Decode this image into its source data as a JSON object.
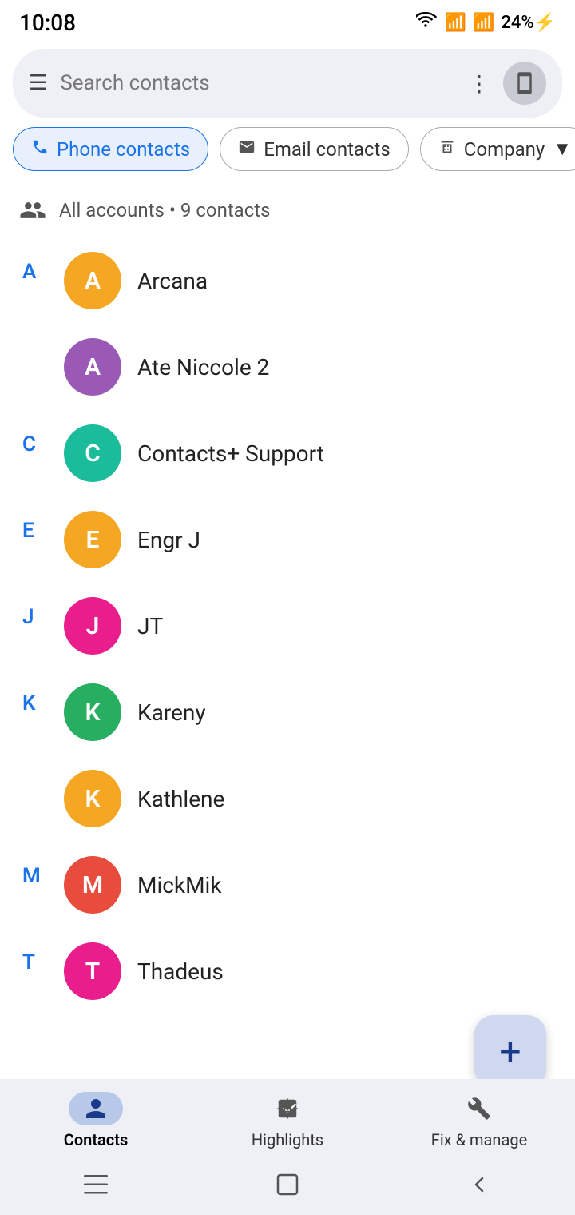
{
  "statusBar": {
    "time": "10:08",
    "battery": "24%",
    "batteryIcon": "⚡"
  },
  "searchBar": {
    "placeholder": "Search contacts",
    "menuIcon": "☰",
    "dotsIcon": "⋮"
  },
  "filterChips": [
    {
      "id": "phone",
      "label": "Phone contacts",
      "icon": "phone",
      "active": true
    },
    {
      "id": "email",
      "label": "Email contacts",
      "icon": "email",
      "active": false
    },
    {
      "id": "company",
      "label": "Company",
      "icon": "company",
      "active": false
    }
  ],
  "accountInfo": {
    "text": "All accounts • 9 contacts"
  },
  "contacts": [
    {
      "letter": "A",
      "name": "Arcana",
      "initial": "A",
      "color": "#F5A623",
      "showLetter": true
    },
    {
      "letter": "A",
      "name": "Ate Niccole 2",
      "initial": "A",
      "color": "#9B59B6",
      "showLetter": false
    },
    {
      "letter": "C",
      "name": "Contacts+ Support",
      "initial": "C",
      "color": "#1ABC9C",
      "showLetter": true
    },
    {
      "letter": "E",
      "name": "Engr J",
      "initial": "E",
      "color": "#F5A623",
      "showLetter": true
    },
    {
      "letter": "J",
      "name": "JT",
      "initial": "J",
      "color": "#E91E8C",
      "showLetter": true
    },
    {
      "letter": "K",
      "name": "Kareny",
      "initial": "K",
      "color": "#27AE60",
      "showLetter": true
    },
    {
      "letter": "K",
      "name": "Kathlene",
      "initial": "K",
      "color": "#F5A623",
      "showLetter": false
    },
    {
      "letter": "M",
      "name": "MickMik",
      "initial": "M",
      "color": "#E74C3C",
      "showLetter": true
    },
    {
      "letter": "T",
      "name": "Thadeus",
      "initial": "T",
      "color": "#E91E8C",
      "showLetter": true
    }
  ],
  "fab": {
    "label": "+"
  },
  "bottomNav": {
    "items": [
      {
        "id": "contacts",
        "label": "Contacts",
        "active": true
      },
      {
        "id": "highlights",
        "label": "Highlights",
        "active": false
      },
      {
        "id": "fix",
        "label": "Fix & manage",
        "active": false
      }
    ]
  }
}
